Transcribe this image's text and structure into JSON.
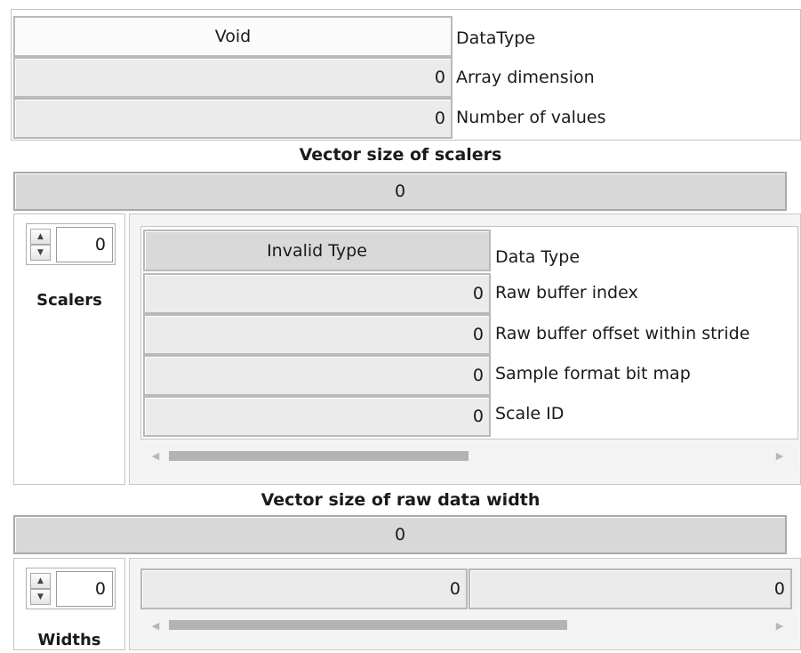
{
  "cluster": {
    "data_type_value": "Void",
    "data_type_label": "DataType",
    "array_dimension_value": "0",
    "array_dimension_label": "Array dimension",
    "number_of_values_value": "0",
    "number_of_values_label": "Number of values"
  },
  "scalers_size": {
    "title": "Vector size of scalers",
    "value": "0"
  },
  "scalers": {
    "index_value": "0",
    "label": "Scalers",
    "element": {
      "data_type_value": "Invalid Type",
      "data_type_label": "Data Type",
      "raw_buffer_index_value": "0",
      "raw_buffer_index_label": "Raw buffer index",
      "raw_buffer_offset_value": "0",
      "raw_buffer_offset_label": "Raw buffer offset within stride",
      "sample_format_value": "0",
      "sample_format_label": "Sample format bit map",
      "scale_id_value": "0",
      "scale_id_label": "Scale ID"
    }
  },
  "widths_size": {
    "title": "Vector size of raw data width",
    "value": "0"
  },
  "widths": {
    "index_value": "0",
    "label": "Widths",
    "element_values": [
      "0",
      "0"
    ]
  },
  "icons": {
    "spin_up": "▲",
    "spin_down": "▼",
    "scroll_left": "◀",
    "scroll_right": "▶"
  }
}
